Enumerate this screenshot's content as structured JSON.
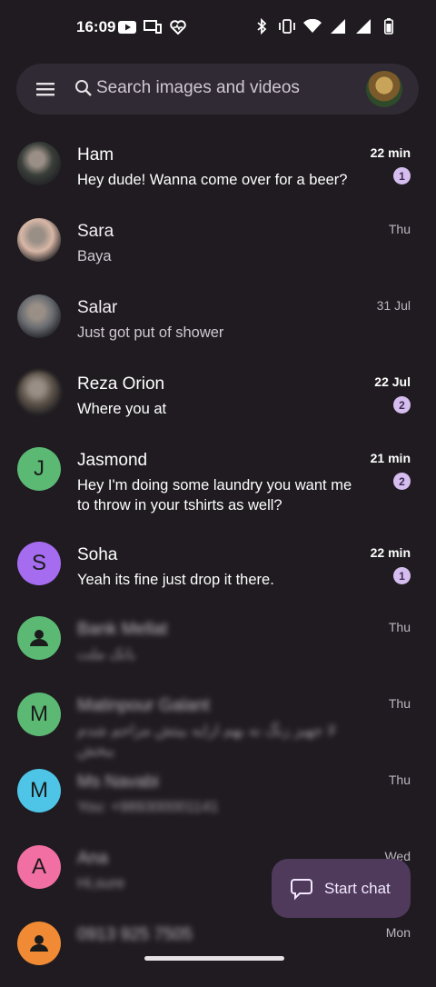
{
  "status_bar": {
    "time": "16:09",
    "left_icons": [
      "youtube-icon",
      "cast-icon",
      "health-icon"
    ],
    "right_icons": [
      "bluetooth-icon",
      "vibrate-icon",
      "wifi-icon",
      "signal-icon",
      "signal-icon",
      "battery-icon"
    ]
  },
  "search": {
    "placeholder": "Search images and videos"
  },
  "conversations": [
    {
      "name": "Ham",
      "snippet": "Hey dude! Wanna come over for a beer?",
      "time": "22 min",
      "unread": "1",
      "avatar_type": "photo",
      "avatar_color": "#3a3f3a"
    },
    {
      "name": "Sara",
      "snippet": "Baya",
      "time": "Thu",
      "unread": "",
      "avatar_type": "photo",
      "avatar_color": "#d8b7a6"
    },
    {
      "name": "Salar",
      "snippet": "Just got put of shower",
      "time": "31 Jul",
      "unread": "",
      "avatar_type": "photo",
      "avatar_color": "#6a6d72"
    },
    {
      "name": "Reza Orion",
      "snippet": "Where you at",
      "time": "22 Jul",
      "unread": "2",
      "avatar_type": "photo",
      "avatar_color": "#5b5147"
    },
    {
      "name": "Jasmond",
      "snippet": "Hey I'm doing some laundry you want me to throw in your tshirts as well?",
      "time": "21 min",
      "unread": "2",
      "avatar_type": "letter",
      "letter": "J",
      "avatar_color": "#5bb974"
    },
    {
      "name": "Soha",
      "snippet": "Yeah its fine just drop it there.",
      "time": "22 min",
      "unread": "1",
      "avatar_type": "letter",
      "letter": "S",
      "avatar_color": "#a56cf0"
    },
    {
      "name": "Bank Mellat",
      "snippet": "بانک ملت",
      "time": "Thu",
      "unread": "",
      "avatar_type": "person",
      "avatar_color": "#5bb974"
    },
    {
      "name": "Matinpour Galant",
      "snippet": "لا جهیز زنگ نه بهم ارایه بیتش مزاحم شدم ببخش",
      "time": "Thu",
      "unread": "",
      "avatar_type": "letter",
      "letter": "M",
      "avatar_color": "#5bb974"
    },
    {
      "name": "Ms Navabi",
      "snippet": "You: +989300001141",
      "time": "Thu",
      "unread": "",
      "avatar_type": "letter",
      "letter": "M",
      "avatar_color": "#4ec5e6"
    },
    {
      "name": "Ana",
      "snippet": "Hi,sure",
      "time": "Wed",
      "unread": "",
      "avatar_type": "letter",
      "letter": "A",
      "avatar_color": "#f26fa4"
    },
    {
      "name": "0913 925 7505",
      "snippet": "",
      "time": "Mon",
      "unread": "",
      "avatar_type": "person",
      "avatar_color": "#f08a34"
    }
  ],
  "fab": {
    "label": "Start chat"
  },
  "colors": {
    "background": "#1f1b20",
    "badge": "#d6bdf0",
    "fab": "#4f3a5c"
  }
}
